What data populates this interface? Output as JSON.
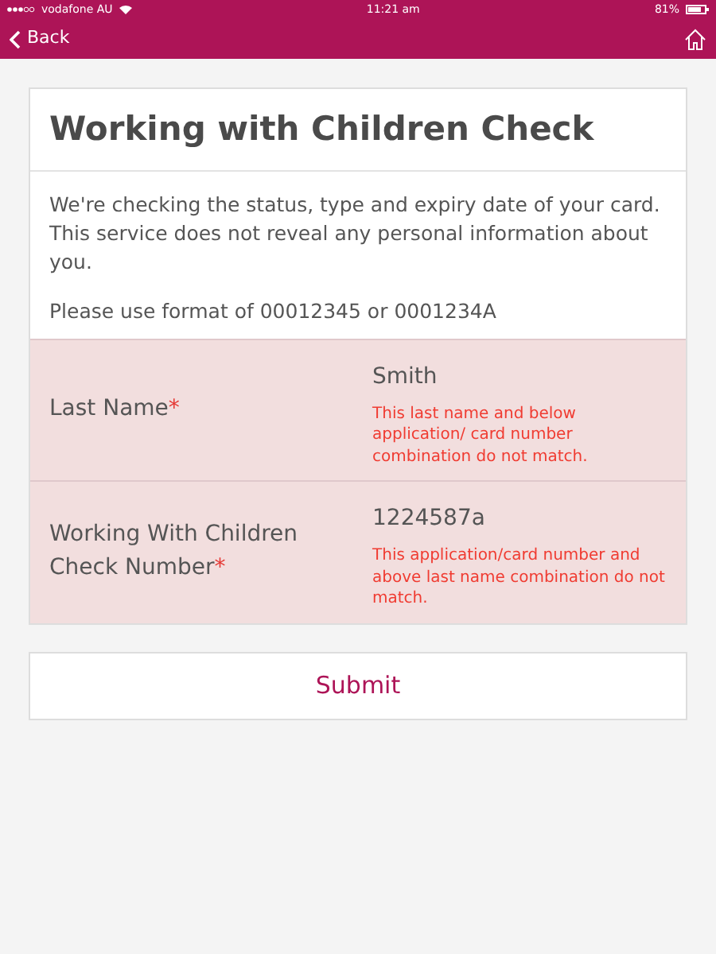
{
  "status_bar": {
    "carrier": "vodafone AU",
    "time": "11:21 am",
    "battery": "81%"
  },
  "nav": {
    "back": "Back"
  },
  "card": {
    "title": "Working with Children Check",
    "intro": "We're checking the status, type and expiry date of your card. This service does not reveal any personal information about you.",
    "format_hint": "Please use format of 00012345 or 0001234A"
  },
  "fields": [
    {
      "label": "Last Name",
      "required_mark": "*",
      "value": "Smith",
      "invalid": true,
      "error": "This last name and below application/ card number combination do not match."
    },
    {
      "label": "Working With Children Check Number",
      "required_mark": "*",
      "value": "1224587a",
      "invalid": true,
      "error": "This application/card number and above last name combination do not match."
    }
  ],
  "submit": "Submit"
}
